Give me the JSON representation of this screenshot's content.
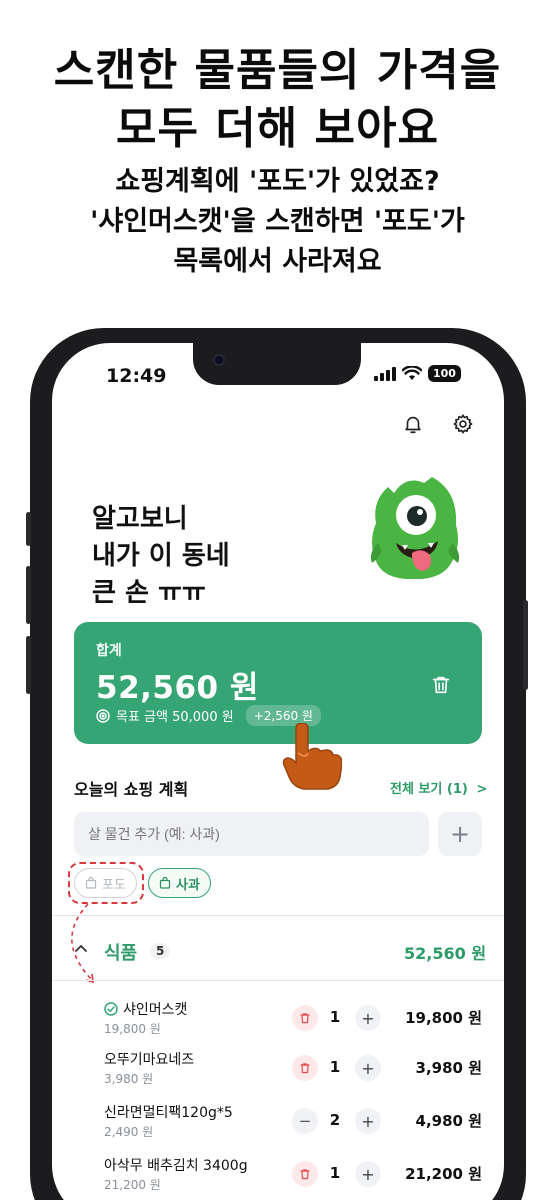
{
  "promo": {
    "title_line1": "스캔한 물품들의 가격을",
    "title_line2": "모두 더해 보아요",
    "sub_line1": "쇼핑계획에 '포도'가 있었죠?",
    "sub_line2": "'샤인머스캣'을 스캔하면 '포도'가",
    "sub_line3": "목록에서 사라져요"
  },
  "status_bar": {
    "time": "12:49",
    "battery": "100"
  },
  "header": {
    "icons": [
      "bell-icon",
      "gear-icon"
    ]
  },
  "hero": {
    "line1": "알고보니",
    "line2": "내가 이 동네",
    "line3": "큰 손 ㅠㅠ"
  },
  "summary": {
    "label": "합계",
    "total": "52,560 원",
    "goal_label": "목표 금액 50,000 원",
    "diff": "+2,560 원",
    "bg_color": "#35a574"
  },
  "plan": {
    "title": "오늘의 쇼핑 계획",
    "see_all": "전체 보기 (1)",
    "see_all_chevron": ">",
    "search_placeholder": "살 물건 추가 (예: 사과)",
    "add_button": "+",
    "chips": [
      {
        "label": "포도",
        "state": "done"
      },
      {
        "label": "사과",
        "state": "active"
      }
    ]
  },
  "category": {
    "title": "식품",
    "count": "5",
    "total": "52,560 원",
    "items": [
      {
        "name": "샤인머스캣",
        "unit_price": "19,800 원",
        "qty": "1",
        "total": "19,800 원",
        "control": "trash",
        "checked": true
      },
      {
        "name": "오뚜기마요네즈",
        "unit_price": "3,980 원",
        "qty": "1",
        "total": "3,980 원",
        "control": "trash",
        "checked": false
      },
      {
        "name": "신라면멀티팩120g*5",
        "unit_price": "2,490 원",
        "qty": "2",
        "total": "4,980 원",
        "control": "minus",
        "checked": false
      },
      {
        "name": "아삭무 배추김치 3400g",
        "unit_price": "21,200 원",
        "qty": "1",
        "total": "21,200 원",
        "control": "trash",
        "checked": false
      }
    ],
    "minus_symbol": "−",
    "plus_symbol": "+"
  },
  "colors": {
    "accent": "#2c9b67",
    "dashed_highlight": "#d9363e"
  }
}
